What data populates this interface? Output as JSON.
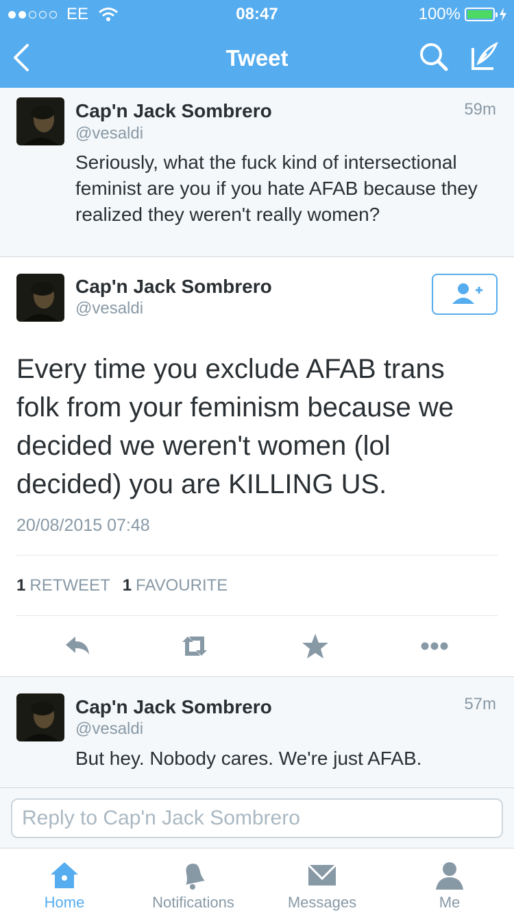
{
  "status_bar": {
    "carrier": "EE",
    "time": "08:47",
    "battery": "100%"
  },
  "nav": {
    "title": "Tweet"
  },
  "tweets_before": [
    {
      "name": "Cap'n Jack Sombrero",
      "handle": "@vesaldi",
      "time": "59m",
      "text": "Seriously, what the fuck kind of intersectional feminist are you if you hate AFAB because they realized they weren't really women?"
    }
  ],
  "main_tweet": {
    "name": "Cap'n Jack Sombrero",
    "handle": "@vesaldi",
    "text": "Every time you exclude AFAB trans folk from your feminism because we decided we weren't women (lol decided) you are KILLING US.",
    "timestamp": "20/08/2015 07:48",
    "retweets_count": "1",
    "retweets_label": "RETWEET",
    "favourites_count": "1",
    "favourites_label": "FAVOURITE"
  },
  "tweets_after": [
    {
      "name": "Cap'n Jack Sombrero",
      "handle": "@vesaldi",
      "time": "57m",
      "text": "But hey. Nobody cares. We're just AFAB."
    }
  ],
  "reply": {
    "placeholder": "Reply to Cap'n Jack Sombrero"
  },
  "tabs": [
    {
      "label": "Home",
      "icon": "home-icon",
      "active": true
    },
    {
      "label": "Notifications",
      "icon": "bell-icon",
      "active": false
    },
    {
      "label": "Messages",
      "icon": "envelope-icon",
      "active": false
    },
    {
      "label": "Me",
      "icon": "person-icon",
      "active": false
    }
  ],
  "colors": {
    "brand": "#55acee",
    "battery": "#4cd964",
    "muted": "#8899a6"
  }
}
